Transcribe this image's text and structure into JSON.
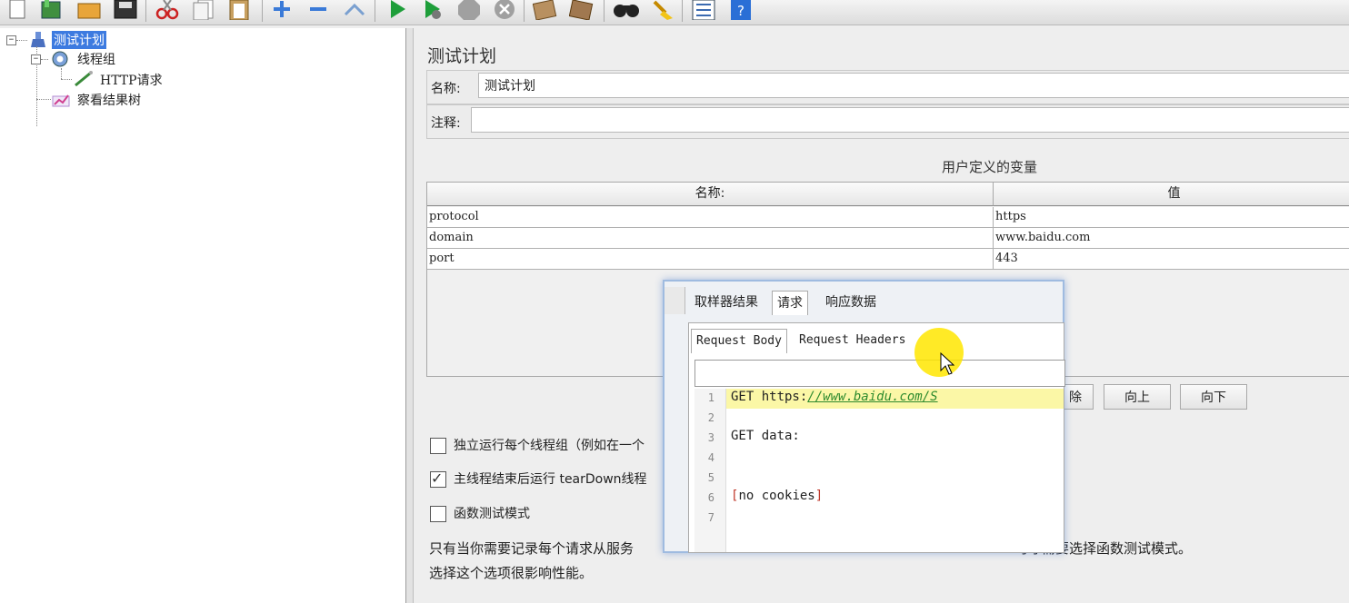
{
  "toolbar": {
    "icons": [
      "new-icon",
      "templates-icon",
      "open-icon",
      "save-icon",
      "cut-icon",
      "copy-icon",
      "paste-icon",
      "expand-icon",
      "collapse-icon",
      "toggle-icon",
      "start-icon",
      "start-no-pause-icon",
      "stop-icon",
      "shutdown-icon",
      "clear-icon",
      "clear-all-icon",
      "search-icon",
      "reset-search-icon",
      "function-helper-icon",
      "help-icon"
    ]
  },
  "tree": {
    "items": [
      {
        "label": "测试计划",
        "icon": "test-plan-icon",
        "selected": true
      },
      {
        "label": "线程组",
        "icon": "thread-group-icon"
      },
      {
        "label": "HTTP请求",
        "icon": "http-sampler-icon"
      },
      {
        "label": "察看结果树",
        "icon": "view-results-tree-icon"
      }
    ]
  },
  "panel": {
    "title": "测试计划",
    "name_label": "名称:",
    "name_value": "测试计划",
    "comment_label": "注释:",
    "comment_value": ""
  },
  "udv": {
    "title": "用户定义的变量",
    "columns": [
      "名称:",
      "值"
    ],
    "rows": [
      {
        "name": "protocol",
        "value": "https"
      },
      {
        "name": "domain",
        "value": "www.baidu.com"
      },
      {
        "name": "port",
        "value": "443"
      }
    ],
    "buttons": {
      "delete_partial": "除",
      "up": "向上",
      "down": "向下"
    }
  },
  "options": {
    "independent_partial": "独立运行每个线程组（例如在一个",
    "independent_checked": false,
    "teardown_partial": "主线程结束后运行 tearDown线程",
    "teardown_checked": true,
    "functional_label": "函数测试模式",
    "functional_checked": false,
    "note_line1_partial": "只有当你需要记录每个请求从服务",
    "note_line1_tail": "时才需要选择函数测试模式。",
    "note_line2": "选择这个选项很影响性能。"
  },
  "popup": {
    "tabs": [
      "取样器结果",
      "请求",
      "响应数据"
    ],
    "active_tab": "请求",
    "subtabs": [
      "Request Body",
      "Request Headers"
    ],
    "active_subtab": "Request Body",
    "search_value": "",
    "lines": [
      {
        "n": "1",
        "prefix": "GET https:",
        "url": "//www.baidu.com/S",
        "text": ""
      },
      {
        "n": "2",
        "text": ""
      },
      {
        "n": "3",
        "text": "GET data:"
      },
      {
        "n": "4",
        "text": ""
      },
      {
        "n": "5",
        "text": ""
      },
      {
        "n": "6",
        "text": "no cookies"
      },
      {
        "n": "7",
        "text": ""
      }
    ],
    "bracket_open": "[",
    "bracket_close": "]"
  }
}
